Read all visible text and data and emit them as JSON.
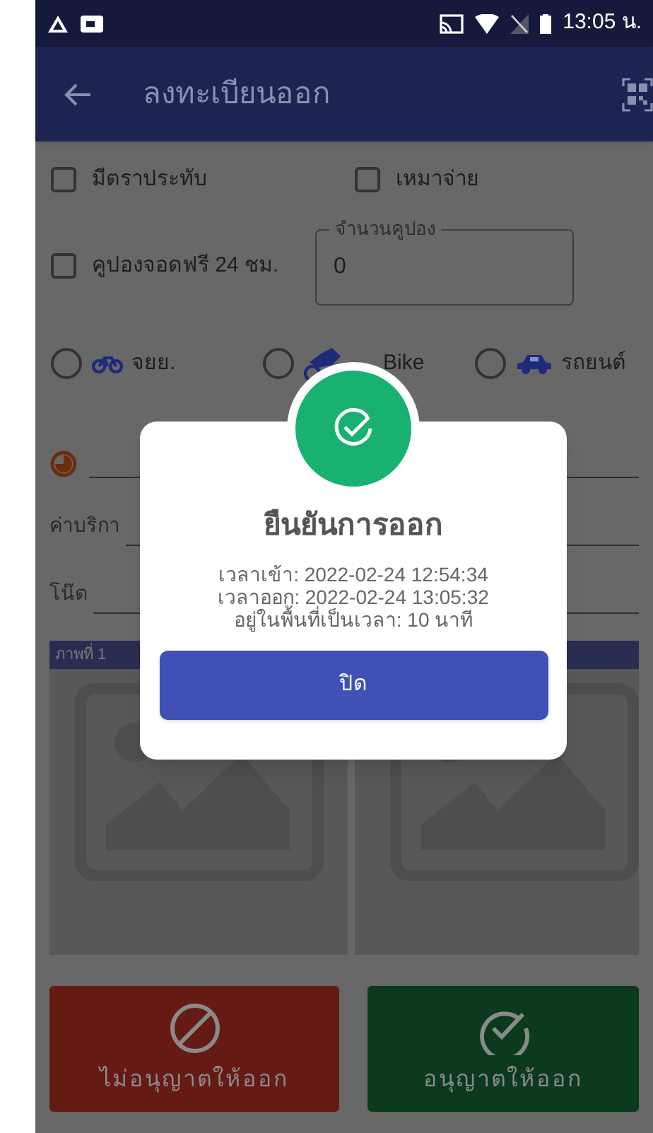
{
  "status_bar": {
    "time": "13:05 น."
  },
  "app_bar": {
    "title": "ลงทะเบียนออก"
  },
  "checkboxes": [
    {
      "label": "มีตราประทับ",
      "checked": false
    },
    {
      "label": "เหมาจ่าย",
      "checked": false
    },
    {
      "label": "คูปองจอดฟรี 24 ชม.",
      "checked": false
    }
  ],
  "coupon_field": {
    "label": "จำนวนคูปอง",
    "value": "0"
  },
  "vehicle_types": [
    {
      "kind": "bicycle",
      "label": "จยย.",
      "selected": false
    },
    {
      "kind": "motorbike",
      "label": "Bike",
      "selected": false
    },
    {
      "kind": "car",
      "label": "รถยนต์",
      "selected": false
    }
  ],
  "fields": [
    {
      "label": "ค่าบริกา"
    },
    {
      "label": "โน๊ต"
    }
  ],
  "photos": [
    {
      "label": "ภาพที่ 1"
    }
  ],
  "actions": [
    {
      "kind": "deny",
      "label": "ไม่อนุญาตให้ออก"
    },
    {
      "kind": "allow",
      "label": "อนุญาตให้ออก"
    }
  ],
  "dialog": {
    "title": "ยืนยันการออก",
    "lines": [
      "เวลาเข้า: 2022-02-24 12:54:34",
      "เวลาออก: 2022-02-24 13:05:32",
      "อยู่ในพื้นที่เป็นเวลา: 10 นาที"
    ],
    "button": "ปิด"
  }
}
